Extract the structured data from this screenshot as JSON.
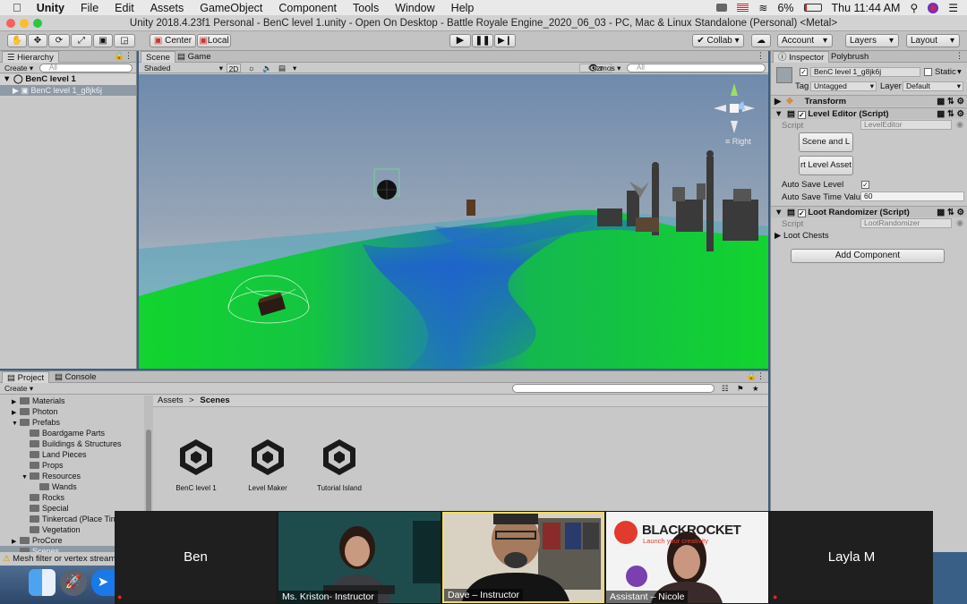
{
  "menubar": {
    "apple": "",
    "app": "Unity",
    "items": [
      "File",
      "Edit",
      "Assets",
      "GameObject",
      "Component",
      "Tools",
      "Window",
      "Help"
    ],
    "battery": "6%",
    "clock": "Thu 11:44 AM"
  },
  "window": {
    "title": "Unity 2018.4.23f1 Personal - BenC level 1.unity - Open On Desktop - Battle Royale Engine_2020_06_03 - PC, Mac & Linux Standalone (Personal) <Metal>"
  },
  "toolbar": {
    "center": "Center",
    "local": "Local",
    "collab": "Collab ▾",
    "account": "Account",
    "layers": "Layers",
    "layout": "Layout"
  },
  "hierarchy": {
    "tab": "Hierarchy",
    "create": "Create ▾",
    "search_placeholder": "All",
    "scene": "BenC level 1",
    "child": "BenC level 1_g8jk6j"
  },
  "scene": {
    "tab_scene": "Scene",
    "tab_game": "Game",
    "shading": "Shaded",
    "mode_2d": "2D",
    "gizmos": "Gizmos ▾",
    "search_placeholder": "All",
    "gizmo_label": "Right"
  },
  "inspector": {
    "tab_inspector": "Inspector",
    "tab_polybrush": "Polybrush",
    "object_name": "BenC level 1_g8jk6j",
    "static": "Static",
    "tag_label": "Tag",
    "tag_value": "Untagged",
    "layer_label": "Layer",
    "layer_value": "Default",
    "transform": "Transform",
    "level_editor": "Level Editor (Script)",
    "script_label": "Script",
    "level_editor_script": "LevelEditor",
    "btn_scene": "Scene and L",
    "btn_asset": "rt Level Asset",
    "auto_save_label": "Auto Save Level",
    "auto_save_time_label": "Auto Save Time Value",
    "auto_save_time_value": "60",
    "loot_randomizer": "Loot Randomizer (Script)",
    "loot_script": "LootRandomizer",
    "loot_chests": "Loot Chests",
    "add_component": "Add Component"
  },
  "project": {
    "tab_project": "Project",
    "tab_console": "Console",
    "create": "Create ▾",
    "breadcrumb_root": "Assets",
    "breadcrumb_sep": ">",
    "breadcrumb_current": "Scenes",
    "tree": [
      {
        "label": "Materials",
        "indent": 1,
        "arrow": "▶"
      },
      {
        "label": "Photon",
        "indent": 1,
        "arrow": "▶"
      },
      {
        "label": "Prefabs",
        "indent": 1,
        "arrow": "▼"
      },
      {
        "label": "Boardgame Parts",
        "indent": 2,
        "arrow": ""
      },
      {
        "label": "Buildings & Structures",
        "indent": 2,
        "arrow": ""
      },
      {
        "label": "Land Pieces",
        "indent": 2,
        "arrow": ""
      },
      {
        "label": "Props",
        "indent": 2,
        "arrow": ""
      },
      {
        "label": "Resources",
        "indent": 2,
        "arrow": "▼"
      },
      {
        "label": "Wands",
        "indent": 3,
        "arrow": ""
      },
      {
        "label": "Rocks",
        "indent": 2,
        "arrow": ""
      },
      {
        "label": "Special",
        "indent": 2,
        "arrow": ""
      },
      {
        "label": "Tinkercad (Place Tin",
        "indent": 2,
        "arrow": ""
      },
      {
        "label": "Vegetation",
        "indent": 2,
        "arrow": ""
      },
      {
        "label": "ProCore",
        "indent": 1,
        "arrow": "▶"
      },
      {
        "label": "Scenes",
        "indent": 1,
        "arrow": ""
      }
    ],
    "assets": [
      "BenC level 1",
      "Level Maker",
      "Tutorial Island"
    ]
  },
  "status": {
    "warning": "Mesh filter or vertex stream"
  },
  "zoom": {
    "participants": [
      "Ben",
      "Ms. Kriston- Instructor",
      "Dave – Instructor",
      "Assistant – Nicole",
      "Layla M"
    ],
    "blackrocket_logo": "BLACKROCKET",
    "blackrocket_tagline": "Launch your creativity"
  },
  "colors": {
    "terrain_green": "#12d42e",
    "terrain_blue": "#1f5fd0",
    "sky_top": "#6f8aac",
    "sky_horizon": "#c7cdd2",
    "zoom_active_border": "#f2dd5a"
  }
}
